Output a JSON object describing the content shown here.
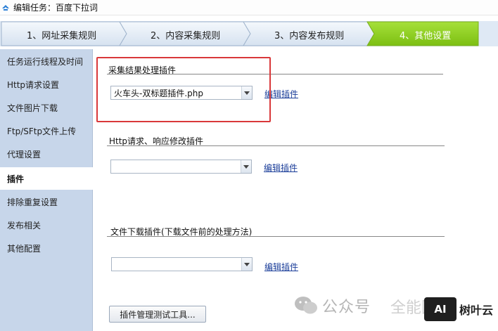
{
  "window": {
    "title": "编辑任务：百度下拉词",
    "icon": "app-logo-icon"
  },
  "steps": [
    {
      "label": "1、网址采集规则",
      "active": false
    },
    {
      "label": "2、内容采集规则",
      "active": false
    },
    {
      "label": "3、内容发布规则",
      "active": false
    },
    {
      "label": "4、其他设置",
      "active": true
    }
  ],
  "sidebar": {
    "items": [
      {
        "label": "任务运行线程及时间",
        "active": false
      },
      {
        "label": "Http请求设置",
        "active": false
      },
      {
        "label": "文件图片下载",
        "active": false
      },
      {
        "label": "Ftp/SFtp文件上传",
        "active": false
      },
      {
        "label": "代理设置",
        "active": false
      },
      {
        "label": "插件",
        "active": true
      },
      {
        "label": "排除重复设置",
        "active": false
      },
      {
        "label": "发布相关",
        "active": false
      },
      {
        "label": "其他配置",
        "active": false
      }
    ]
  },
  "sections": {
    "result_plugin": {
      "label": "采集结果处理插件",
      "value": "火车头-双标题插件.php",
      "edit_link": "编辑插件"
    },
    "http_plugin": {
      "label": "Http请求、响应修改插件",
      "value": "",
      "edit_link": "编辑插件"
    },
    "download_plugin": {
      "label": "文件下载插件(下载文件前的处理方法)",
      "value": "",
      "edit_link": "编辑插件"
    }
  },
  "plugin_tool_button": "插件管理测试工具...",
  "watermark": {
    "text": "公众号",
    "text2": "全能回家",
    "logo": "AI",
    "logo_text": "树叶云"
  },
  "colors": {
    "active_step": "#8ccc1e",
    "sidebar_bg": "#c7d6ea",
    "highlight": "#d9383a",
    "link": "#1a3d99"
  }
}
